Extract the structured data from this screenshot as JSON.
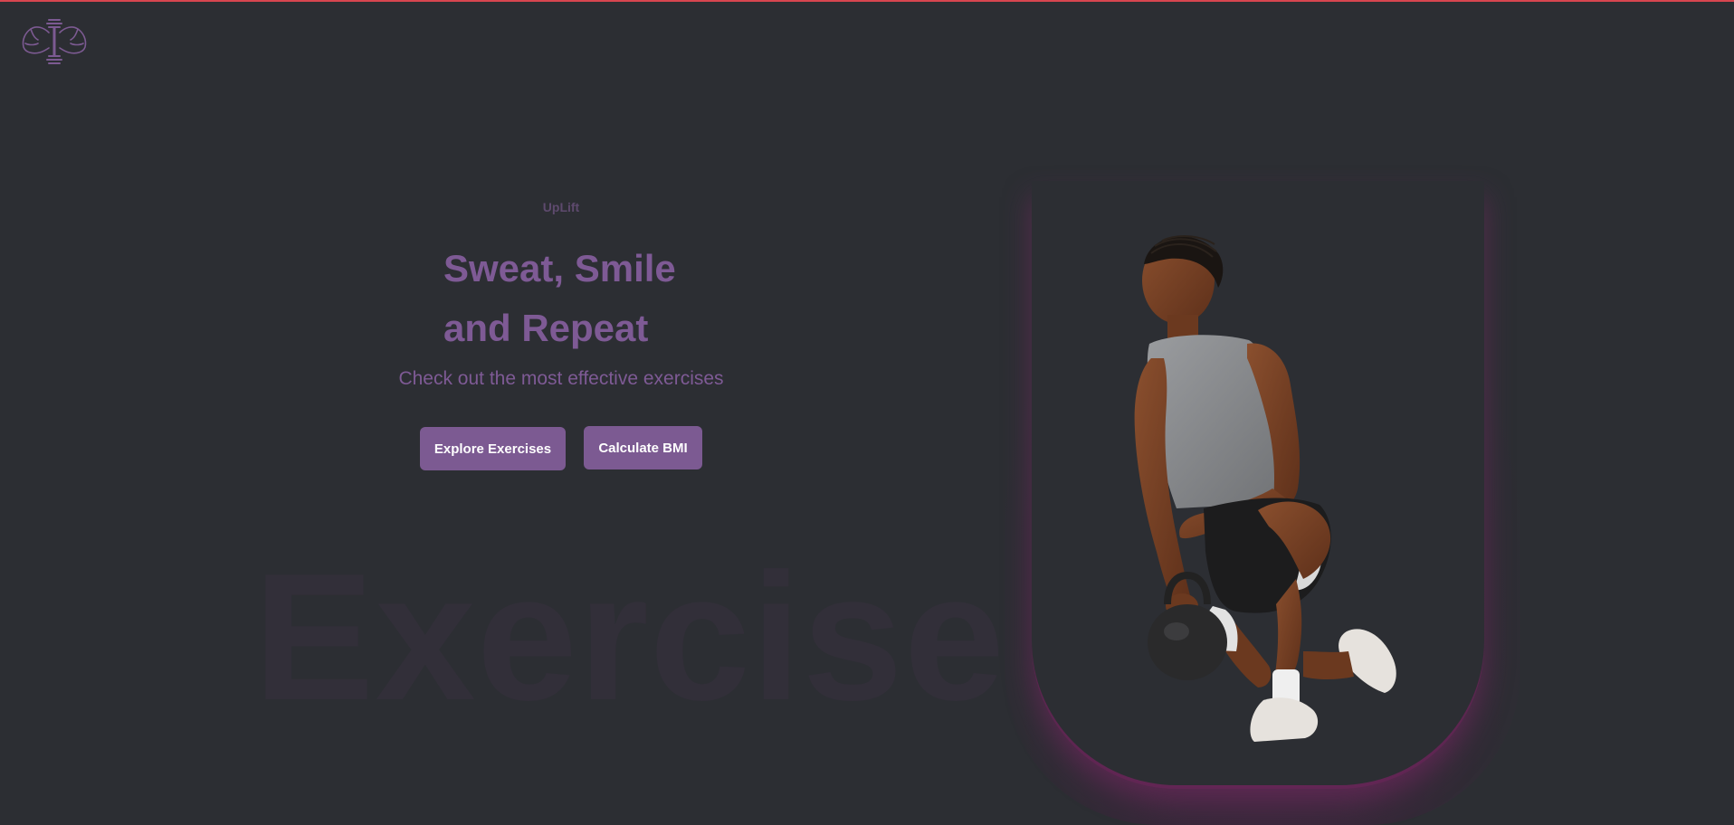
{
  "header": {
    "logo_icon": "muscle-dumbbell-logo-icon",
    "accent_line_color": "#d8464f"
  },
  "hero": {
    "brand": "UpLift",
    "headline_line1": "Sweat, Smile",
    "headline_line2": "and Repeat",
    "subtitle": "Check out the most effective exercises",
    "buttons": {
      "explore": "Explore Exercises",
      "bmi": "Calculate BMI"
    },
    "watermark": "Exercise"
  },
  "colors": {
    "background": "#2c2e33",
    "accent": "#7c5a92",
    "glow": "#5a2350"
  }
}
